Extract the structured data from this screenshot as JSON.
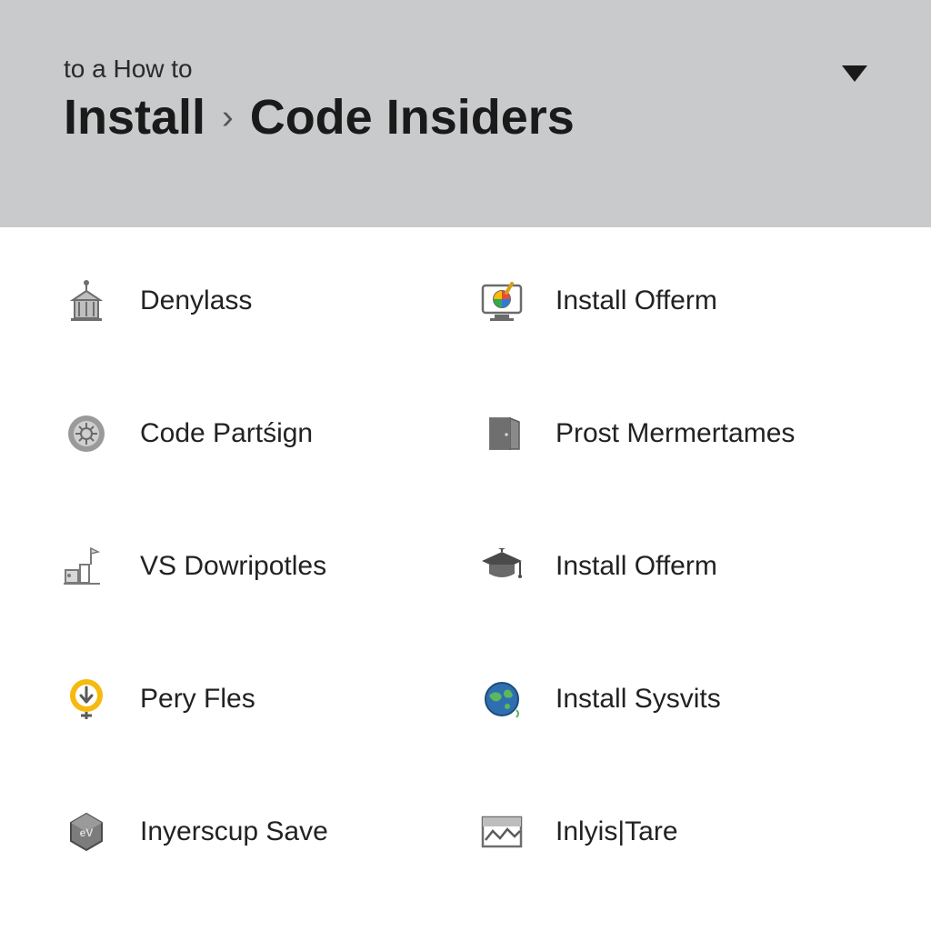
{
  "header": {
    "eyebrow": "to a How to",
    "crumb1": "Install",
    "crumb2": "Code Insiders"
  },
  "items": [
    {
      "label": "Denylass"
    },
    {
      "label": "Install Offerm"
    },
    {
      "label": "Code Partśign"
    },
    {
      "label": "Prost Mermertames"
    },
    {
      "label": "VS Dowripotles"
    },
    {
      "label": "Install Offerm"
    },
    {
      "label": "Pery Fles"
    },
    {
      "label": "Install Sysvits"
    },
    {
      "label": "Inyerscup Save"
    },
    {
      "label": "Inlyis|Tare"
    }
  ]
}
